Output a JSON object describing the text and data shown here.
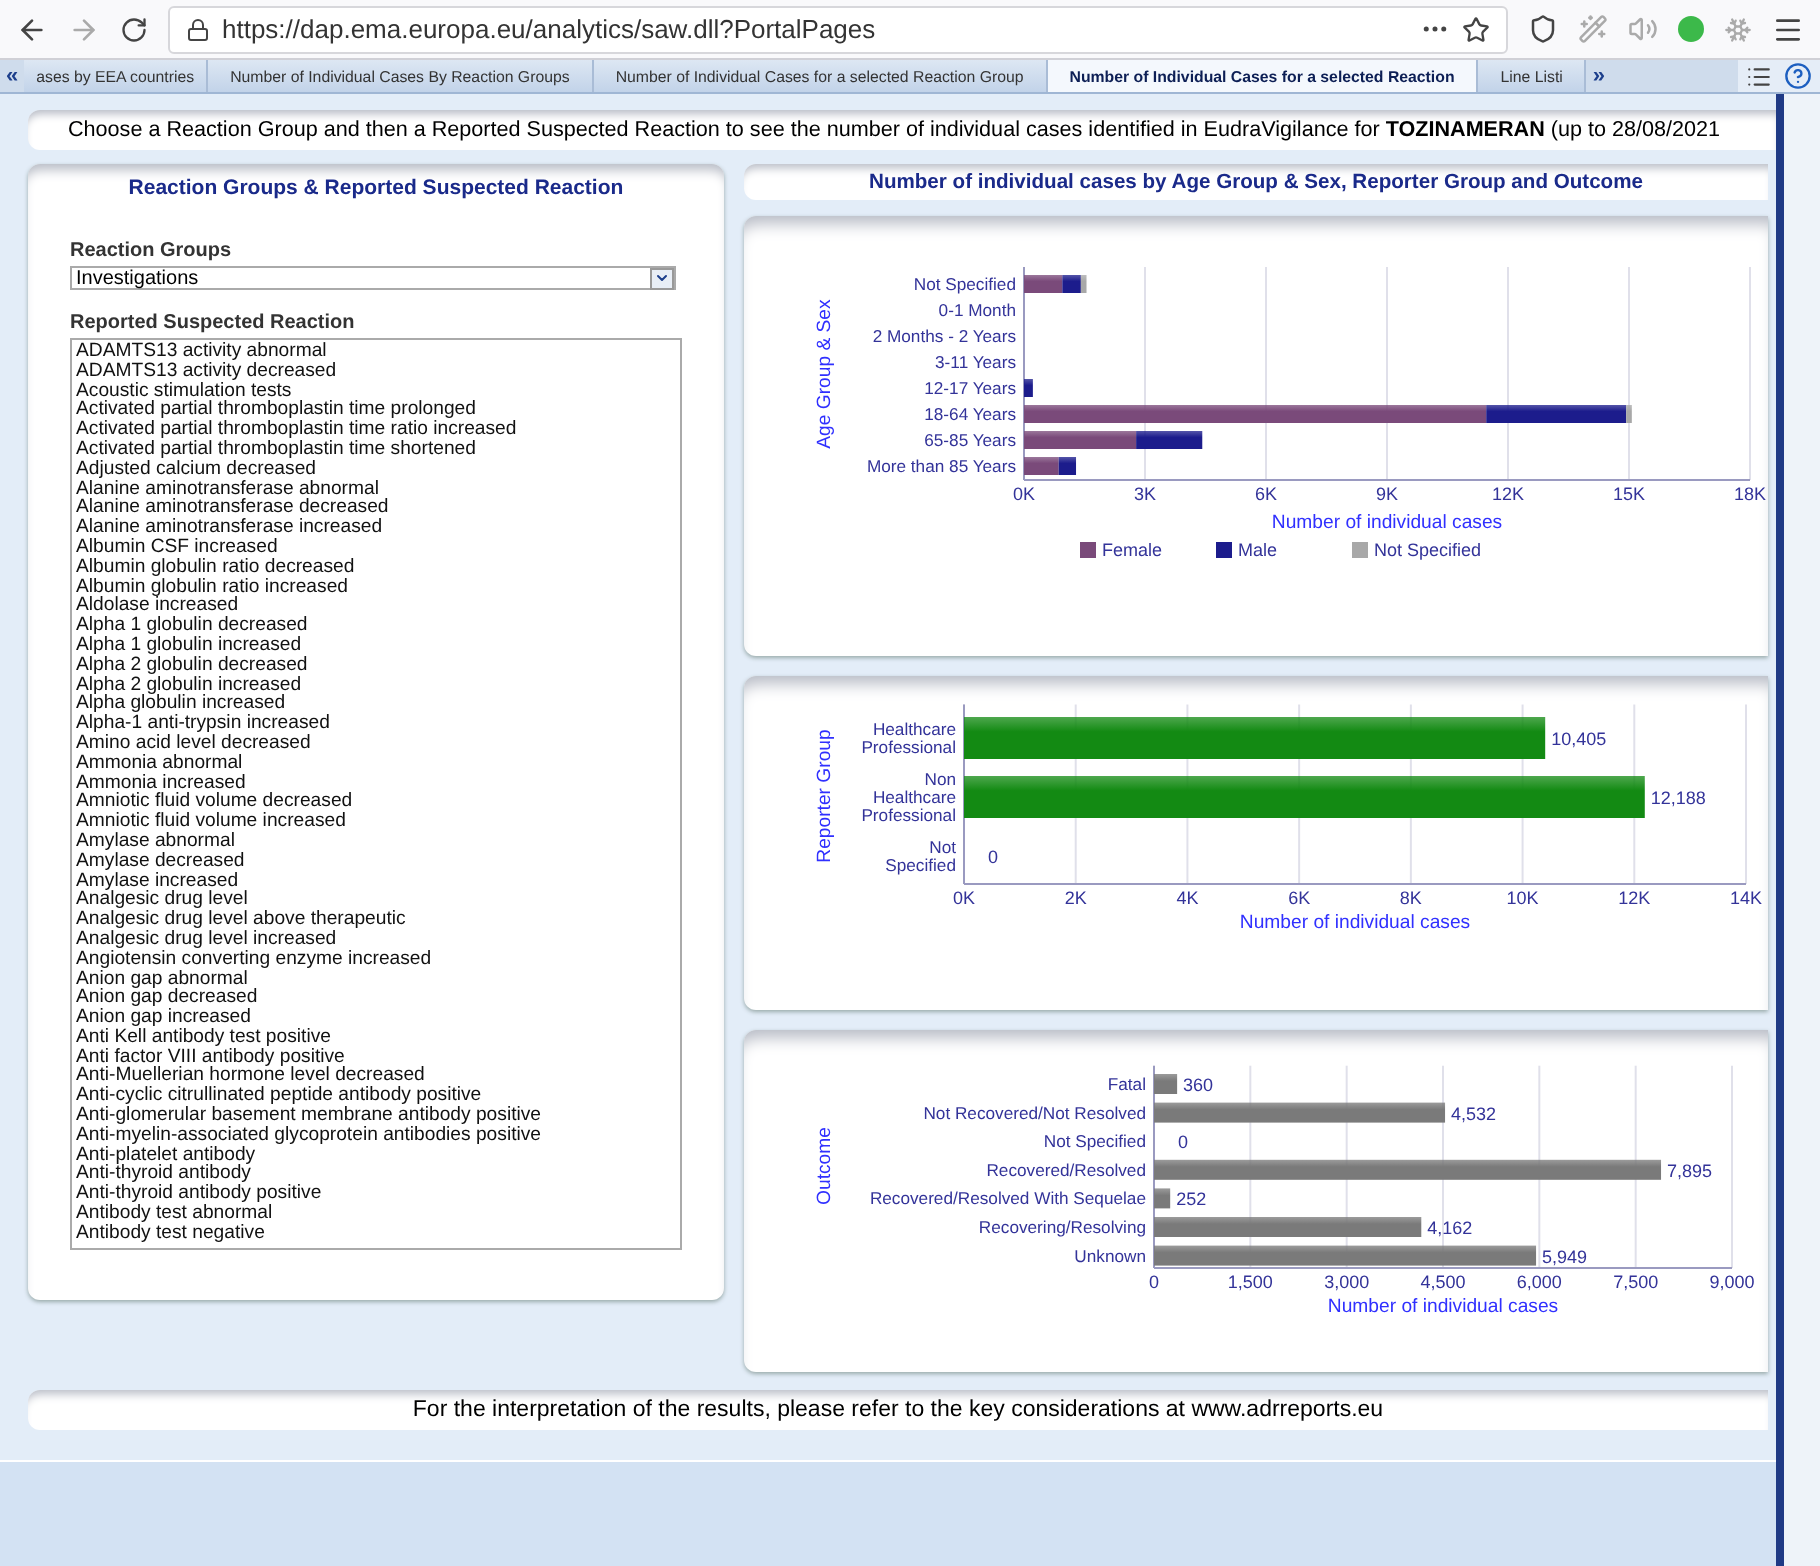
{
  "browser": {
    "url": "https://dap.ema.europa.eu/analytics/saw.dll?PortalPages"
  },
  "tabs": {
    "scroll_left": "«",
    "scroll_right": "»",
    "items": [
      {
        "label": "ases by EEA countries",
        "selected": false
      },
      {
        "label": "Number of Individual Cases By Reaction Groups",
        "selected": false
      },
      {
        "label": "Number of Individual Cases for a selected Reaction Group",
        "selected": false
      },
      {
        "label": "Number of Individual Cases for a selected Reaction",
        "selected": true
      },
      {
        "label": "Line Listi",
        "selected": false
      }
    ]
  },
  "banner": "Choose a Reaction Group and then a Reported Suspected Reaction to see the number of individual cases identified in EudraVigilance for **TOZINAMERAN** (up to 28/08/2021",
  "reaction_panel": {
    "title": "Reaction Groups & Reported Suspected Reaction",
    "group_label": "Reaction Groups",
    "group_value": "Investigations",
    "reaction_label": "Reported Suspected Reaction",
    "reactions": [
      {
        "label": "ADAMTS13 activity abnormal",
        "selected": false
      },
      {
        "label": "ADAMTS13 activity decreased",
        "selected": false
      },
      {
        "label": "Acoustic stimulation tests",
        "selected": false
      },
      {
        "label": "Activated partial thromboplastin time prolonged",
        "selected": false
      },
      {
        "label": "Activated partial thromboplastin time ratio increased",
        "selected": false
      },
      {
        "label": "Activated partial thromboplastin time shortened",
        "selected": false
      },
      {
        "label": "Adjusted calcium decreased",
        "selected": false
      },
      {
        "label": "Alanine aminotransferase abnormal",
        "selected": false
      },
      {
        "label": "Alanine aminotransferase decreased",
        "selected": false
      },
      {
        "label": "Alanine aminotransferase increased",
        "selected": false
      },
      {
        "label": "Albumin CSF increased",
        "selected": false
      },
      {
        "label": "Albumin globulin ratio decreased",
        "selected": false
      },
      {
        "label": "Albumin globulin ratio increased",
        "selected": false
      },
      {
        "label": "Aldolase increased",
        "selected": false
      },
      {
        "label": "Alpha 1 globulin decreased",
        "selected": false
      },
      {
        "label": "Alpha 1 globulin increased",
        "selected": false
      },
      {
        "label": "Alpha 2 globulin decreased",
        "selected": false
      },
      {
        "label": "Alpha 2 globulin increased",
        "selected": false
      },
      {
        "label": "Alpha globulin increased",
        "selected": false
      },
      {
        "label": "Alpha-1 anti-trypsin increased",
        "selected": false
      },
      {
        "label": "Amino acid level decreased",
        "selected": false
      },
      {
        "label": "Ammonia abnormal",
        "selected": false
      },
      {
        "label": "Ammonia increased",
        "selected": false
      },
      {
        "label": "Amniotic fluid volume decreased",
        "selected": false
      },
      {
        "label": "Amniotic fluid volume increased",
        "selected": false
      },
      {
        "label": "Amylase abnormal",
        "selected": false
      },
      {
        "label": "Amylase decreased",
        "selected": false
      },
      {
        "label": "Amylase increased",
        "selected": false
      },
      {
        "label": "Analgesic drug level",
        "selected": false
      },
      {
        "label": "Analgesic drug level above therapeutic",
        "selected": false
      },
      {
        "label": "Analgesic drug level increased",
        "selected": false
      },
      {
        "label": "Angiotensin converting enzyme increased",
        "selected": false
      },
      {
        "label": "Anion gap abnormal",
        "selected": false
      },
      {
        "label": "Anion gap decreased",
        "selected": false
      },
      {
        "label": "Anion gap increased",
        "selected": false
      },
      {
        "label": "Anti Kell antibody test positive",
        "selected": false
      },
      {
        "label": "Anti factor VIII antibody positive",
        "selected": false
      },
      {
        "label": "Anti-Muellerian hormone level decreased",
        "selected": false
      },
      {
        "label": "Anti-cyclic citrullinated peptide antibody positive",
        "selected": false
      },
      {
        "label": "Anti-glomerular basement membrane antibody positive",
        "selected": false
      },
      {
        "label": "Anti-myelin-associated glycoprotein antibodies positive",
        "selected": false
      },
      {
        "label": "Anti-platelet antibody",
        "selected": false
      },
      {
        "label": "Anti-thyroid antibody",
        "selected": false
      },
      {
        "label": "Anti-thyroid antibody positive",
        "selected": false
      },
      {
        "label": "Antibody test abnormal",
        "selected": false
      },
      {
        "label": "Antibody test negative",
        "selected": false
      }
    ]
  },
  "charts_header": "Number of individual cases by Age Group & Sex, Reporter Group and Outcome",
  "age_chart": {
    "chart_data": {
      "type": "bar",
      "orientation": "horizontal",
      "stacked": true,
      "xlabel": "Number of individual cases",
      "ylabel": "Age Group & Sex",
      "categories": [
        "Not Specified",
        "0-1 Month",
        "2 Months - 2 Years",
        "3-11 Years",
        "12-17 Years",
        "18-64 Years",
        "65-85 Years",
        "More than 85 Years"
      ],
      "series": [
        {
          "name": "Female",
          "color": "#7a4a7a",
          "values": [
            950,
            0,
            0,
            0,
            0,
            11460,
            2780,
            860
          ]
        },
        {
          "name": "Male",
          "color": "#1c1c8c",
          "values": [
            460,
            0,
            0,
            0,
            220,
            3470,
            1640,
            430
          ]
        },
        {
          "name": "Not Specified",
          "color": "#a8a8a8",
          "values": [
            140,
            0,
            0,
            0,
            0,
            140,
            0,
            0
          ]
        }
      ],
      "xlim": [
        0,
        18000
      ],
      "grid": true,
      "legend": true,
      "xticks": [
        {
          "value": 0,
          "label": "0K"
        },
        {
          "value": 3000,
          "label": "3K"
        },
        {
          "value": 6000,
          "label": "6K"
        },
        {
          "value": 9000,
          "label": "9K"
        },
        {
          "value": 12000,
          "label": "12K"
        },
        {
          "value": 15000,
          "label": "15K"
        },
        {
          "value": 18000,
          "label": "18K"
        }
      ]
    }
  },
  "reporter_chart": {
    "chart_data": {
      "type": "bar",
      "orientation": "horizontal",
      "xlabel": "Number of individual cases",
      "ylabel": "Reporter Group",
      "categories": [
        "Healthcare Professional",
        "Non Healthcare Professional",
        "Not Specified"
      ],
      "series": [
        {
          "color": "#138a13",
          "values": [
            10405,
            12188,
            0
          ]
        }
      ],
      "xlim": [
        0,
        14000
      ],
      "grid": true,
      "value_labels": [
        "10,405",
        "12,188",
        "0"
      ],
      "xticks": [
        {
          "value": 0,
          "label": "0K"
        },
        {
          "value": 2000,
          "label": "2K"
        },
        {
          "value": 4000,
          "label": "4K"
        },
        {
          "value": 6000,
          "label": "6K"
        },
        {
          "value": 8000,
          "label": "8K"
        },
        {
          "value": 10000,
          "label": "10K"
        },
        {
          "value": 12000,
          "label": "12K"
        },
        {
          "value": 14000,
          "label": "14K"
        }
      ]
    }
  },
  "outcome_chart": {
    "chart_data": {
      "type": "bar",
      "orientation": "horizontal",
      "xlabel": "Number of individual cases",
      "ylabel": "Outcome",
      "categories": [
        "Fatal",
        "Not Recovered/Not Resolved",
        "Not Specified",
        "Recovered/Resolved",
        "Recovered/Resolved With Sequelae",
        "Recovering/Resolving",
        "Unknown"
      ],
      "series": [
        {
          "color": "#7a7a7a",
          "values": [
            360,
            4532,
            0,
            7895,
            252,
            4162,
            5949
          ]
        }
      ],
      "xlim": [
        0,
        9000
      ],
      "grid": true,
      "value_labels": [
        "360",
        "4,532",
        "0",
        "7,895",
        "252",
        "4,162",
        "5,949"
      ],
      "xticks": [
        {
          "value": 0,
          "label": "0"
        },
        {
          "value": 1500,
          "label": "1,500"
        },
        {
          "value": 3000,
          "label": "3,000"
        },
        {
          "value": 4500,
          "label": "4,500"
        },
        {
          "value": 6000,
          "label": "6,000"
        },
        {
          "value": 7500,
          "label": "7,500"
        },
        {
          "value": 9000,
          "label": "9,000"
        }
      ]
    }
  },
  "footer": "For the interpretation of the results, please refer to the key considerations at www.adrreports.eu"
}
